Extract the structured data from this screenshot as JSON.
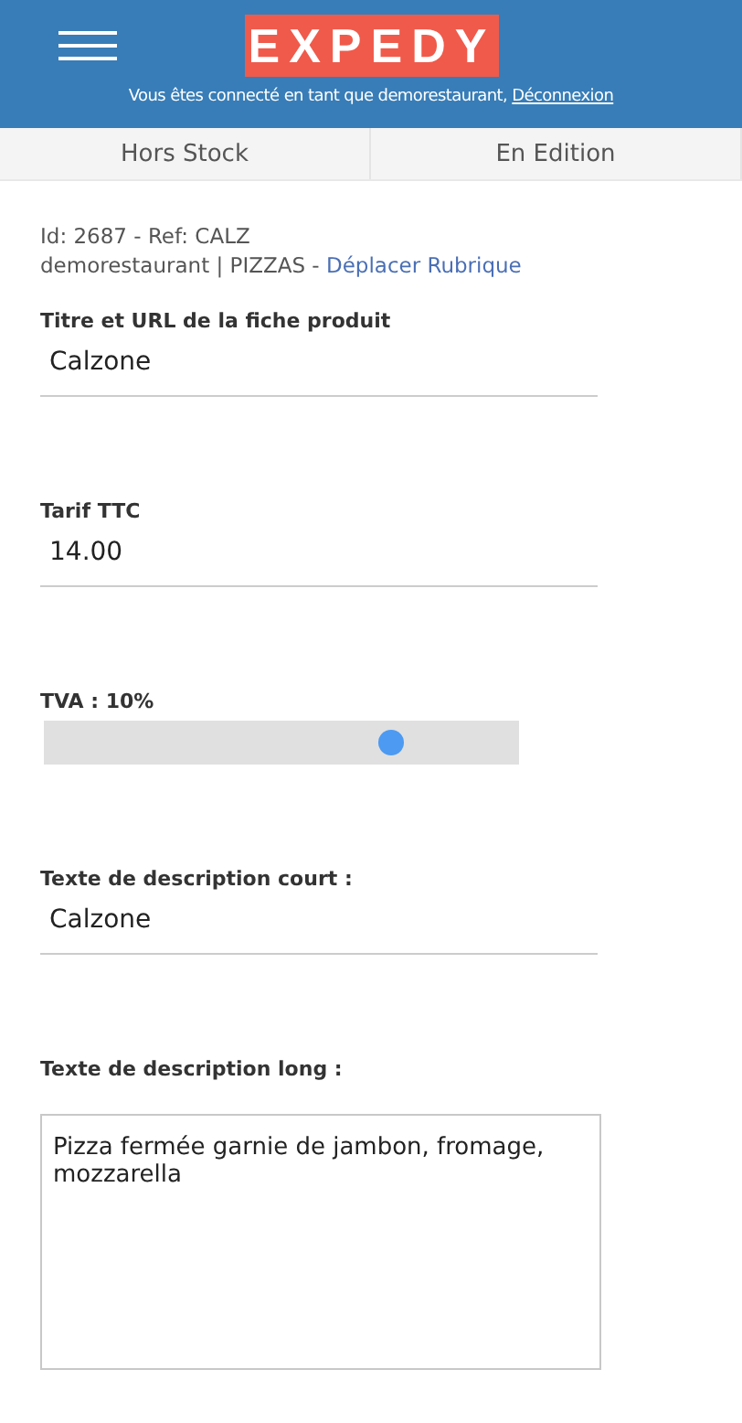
{
  "header": {
    "logo": "EXPEDY",
    "login_text": "Vous êtes connecté en tant que demorestaurant,",
    "logout_link": "Déconnexion"
  },
  "tabs": [
    {
      "label": "Hors Stock",
      "selected": false
    },
    {
      "label": "En Edition",
      "selected": false
    }
  ],
  "product": {
    "id_line": "Id: 2687 - Ref: CALZ",
    "category_text": "demorestaurant | PIZZAS -",
    "move_link": "Déplacer Rubrique"
  },
  "fields": [
    {
      "kind": "text",
      "label": "Titre et URL de la fiche produit",
      "value": "Calzone"
    },
    {
      "kind": "text",
      "label": "Tarif TTC",
      "value": "14.00"
    },
    {
      "kind": "slider",
      "label": "TVA : 10%",
      "level": 0.73
    },
    {
      "kind": "text",
      "label": "Texte de description court :",
      "value": "Calzone"
    },
    {
      "kind": "textarea",
      "label": "Texte de description long :",
      "value": "Pizza fermée garnie de jambon, fromage, mozzarella"
    }
  ]
}
